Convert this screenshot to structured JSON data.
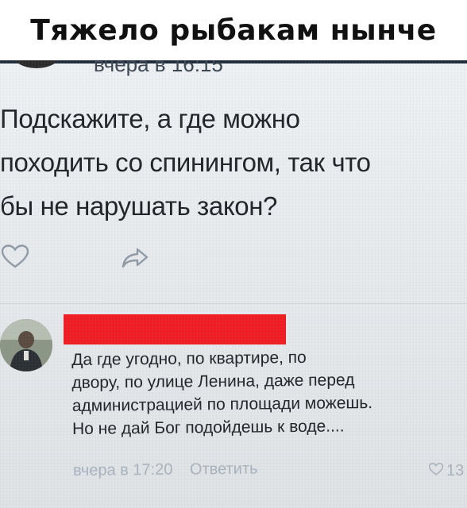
{
  "caption": "Тяжело рыбакам нынче",
  "post": {
    "time": "вчера в 16:15",
    "text_lines": [
      "Подскажите, а где можно",
      "походить со спинингом, так что",
      "бы не нарушать закон?"
    ]
  },
  "actions": {
    "like_icon": "heart-outline-icon",
    "share_icon": "share-arrow-icon"
  },
  "comment": {
    "author_redacted_color": "#f01c22",
    "text_lines": [
      "Да где угодно, по квартире, по",
      "двору, по улице Ленина, даже перед",
      "администрацией по площади можешь.",
      "Но не дай Бог подойдешь к воде...."
    ],
    "time": "вчера в 17:20",
    "reply_label": "Ответить",
    "likes": "13"
  }
}
